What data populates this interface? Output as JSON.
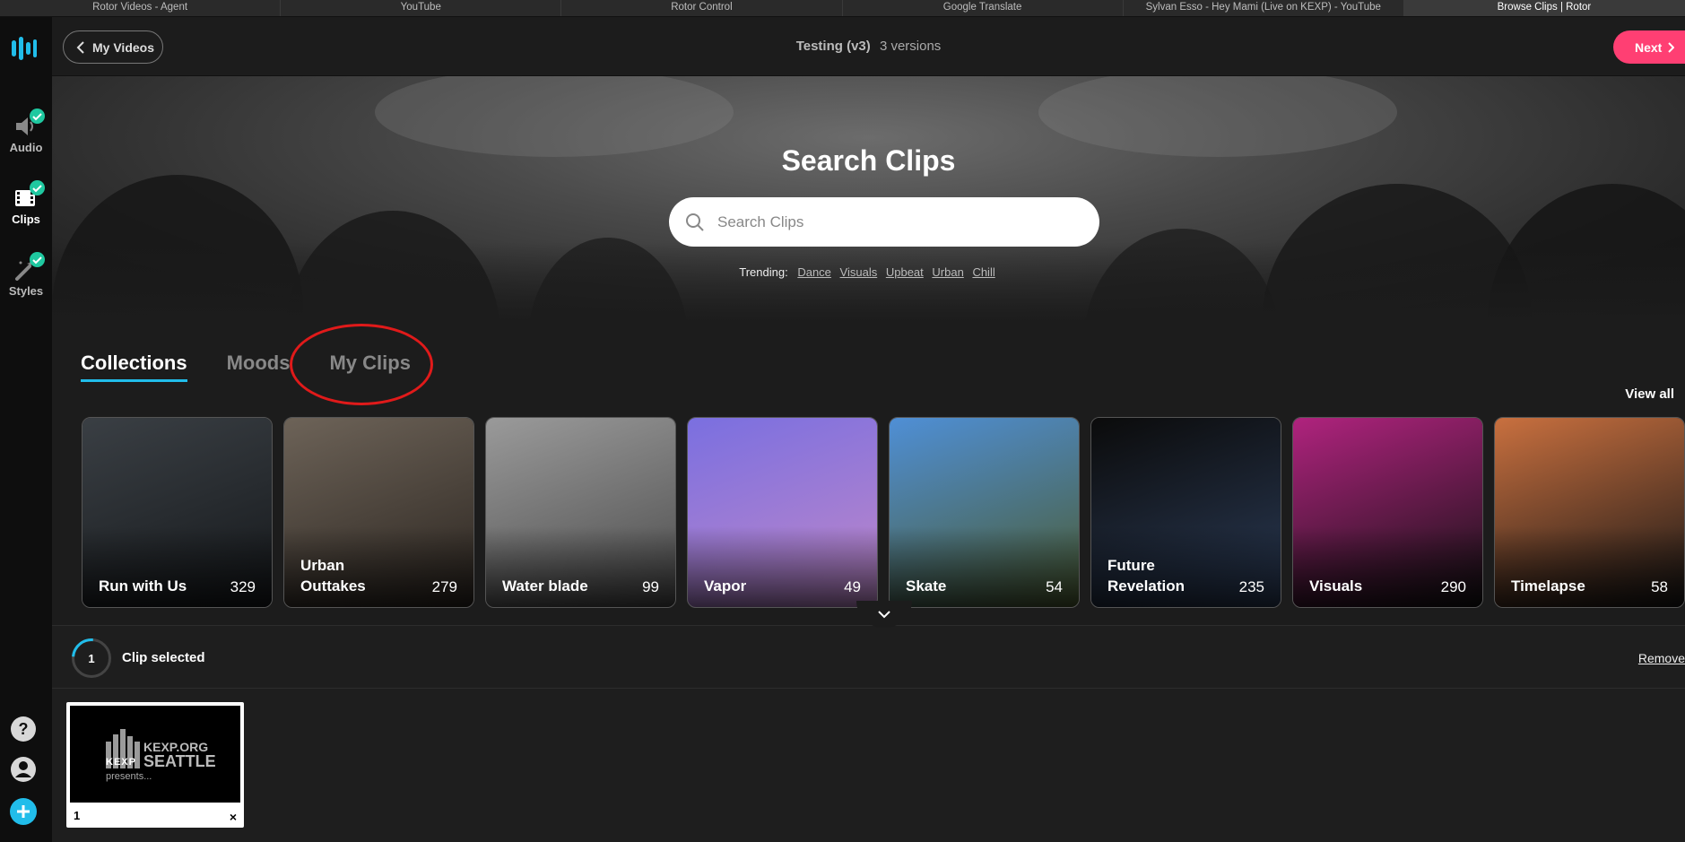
{
  "browser_tabs": [
    {
      "label": "Rotor Videos - Agent",
      "active": false
    },
    {
      "label": "YouTube",
      "active": false
    },
    {
      "label": "Rotor Control",
      "active": false
    },
    {
      "label": "Google Translate",
      "active": false
    },
    {
      "label": "Sylvan Esso - Hey Mami (Live on KEXP) - YouTube",
      "active": false
    },
    {
      "label": "Browse Clips | Rotor",
      "active": true
    }
  ],
  "sidebar": {
    "items": [
      {
        "label": "Audio",
        "icon": "speaker-icon",
        "done": true
      },
      {
        "label": "Clips",
        "icon": "film-icon",
        "done": true
      },
      {
        "label": "Styles",
        "icon": "magic-wand-icon",
        "done": true
      }
    ],
    "bottom_icons": [
      "help-icon",
      "user-icon",
      "add-icon"
    ]
  },
  "topbar": {
    "back_label": "My Videos",
    "project_name": "Testing (v3)",
    "versions": "3 versions",
    "next_label": "Next"
  },
  "hero": {
    "title": "Search Clips",
    "search_placeholder": "Search Clips",
    "trending_label": "Trending:",
    "trending_tags": [
      "Dance",
      "Visuals",
      "Upbeat",
      "Urban",
      "Chill"
    ]
  },
  "collection_tabs": [
    {
      "label": "Collections",
      "active": true
    },
    {
      "label": "Moods",
      "active": false
    },
    {
      "label": "My Clips",
      "active": false
    }
  ],
  "view_all_label": "View all",
  "collections": [
    {
      "name": "Run with Us",
      "count": "329",
      "c1": "#3a3f44",
      "c2": "#15181b"
    },
    {
      "name": "Urban Outtakes",
      "count": "279",
      "c1": "#6d6358",
      "c2": "#2a241f"
    },
    {
      "name": "Water blade",
      "count": "99",
      "c1": "#9a9a9a",
      "c2": "#4a4a4a"
    },
    {
      "name": "Vapor",
      "count": "49",
      "c1": "#7a6fe0",
      "c2": "#c088c9"
    },
    {
      "name": "Skate",
      "count": "54",
      "c1": "#4f8fd6",
      "c2": "#4a5a2f"
    },
    {
      "name": "Future Revelation",
      "count": "235",
      "c1": "#0b0b0b",
      "c2": "#2a3a55"
    },
    {
      "name": "Visuals",
      "count": "290",
      "c1": "#b0237e",
      "c2": "#111111"
    },
    {
      "name": "Timelapse",
      "count": "58",
      "c1": "#c9703f",
      "c2": "#151515"
    }
  ],
  "selection": {
    "count": "1",
    "label": "Clip selected",
    "remove_label": "Remove",
    "clips": [
      {
        "index": "1",
        "logo_text_top": "KEXP.ORG",
        "logo_text_bottom": "SEATTLE",
        "logo_text_small": "presents...",
        "logo_mark": "KEXP"
      }
    ]
  },
  "colors": {
    "accent": "#21bdea",
    "next_button": "#ff3f73",
    "check": "#1fc8a0",
    "annotation": "#e01a1a"
  }
}
